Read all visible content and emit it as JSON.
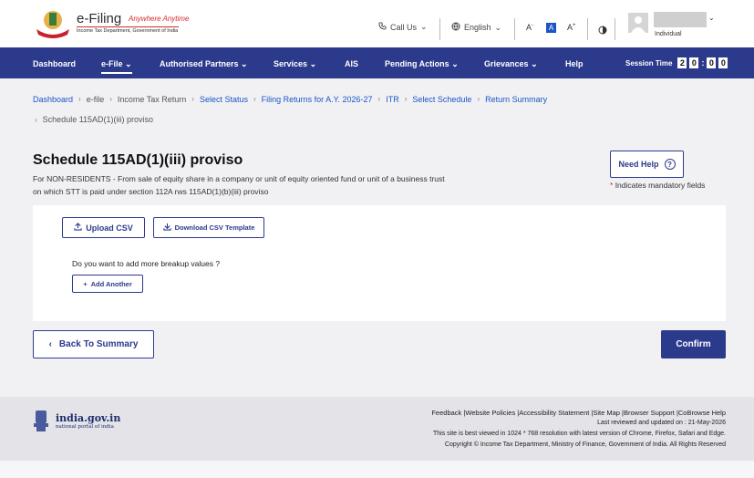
{
  "header": {
    "logo_title": "e-Filing",
    "logo_tagline": "Anywhere Anytime",
    "logo_subtitle": "Income Tax Department, Government of India",
    "call_us": "Call Us",
    "language": "English",
    "font_decrease": "A",
    "font_normal": "A",
    "font_increase": "A",
    "user_role": "Individual"
  },
  "nav": {
    "items": [
      {
        "label": "Dashboard"
      },
      {
        "label": "e-File"
      },
      {
        "label": "Authorised Partners"
      },
      {
        "label": "Services"
      },
      {
        "label": "AIS"
      },
      {
        "label": "Pending Actions"
      },
      {
        "label": "Grievances"
      },
      {
        "label": "Help"
      }
    ],
    "session_label": "Session Time",
    "session_digits": [
      "2",
      "0",
      "0",
      "0"
    ]
  },
  "breadcrumb": {
    "items": [
      {
        "label": "Dashboard"
      },
      {
        "label": "e-file"
      },
      {
        "label": "Income Tax Return"
      },
      {
        "label": "Select Status"
      },
      {
        "label": "Filing Returns for A.Y. 2026-27"
      },
      {
        "label": "ITR"
      },
      {
        "label": "Select Schedule"
      },
      {
        "label": "Return Summary"
      }
    ],
    "current": "Schedule 115AD(1)(iii) proviso"
  },
  "main": {
    "title": "Schedule 115AD(1)(iii) proviso",
    "description_line1": "For NON-RESIDENTS - From sale of equity share in a company or unit of equity oriented fund or unit of a business trust",
    "description_line2": "on which STT is paid under section 112A rws 115AD(1)(b)(iii) proviso",
    "help_label": "Need Help",
    "mandatory_star": "*",
    "mandatory_note": "Indicates mandatory fields",
    "upload_csv": "Upload CSV",
    "download_template": "Download CSV Template",
    "breakup_question": "Do you want to add more breakup values ?",
    "add_another": "Add Another",
    "back_label": "Back To Summary",
    "confirm_label": "Confirm"
  },
  "footer": {
    "site_name": "india.gov.in",
    "site_sub": "national portal of india",
    "links": "Feedback |Website Policies |Accessibility Statement |Site Map |Browser Support |CoBrowse Help",
    "last_reviewed": "Last reviewed and updated on : 21-May-2026",
    "best_viewed": "This site is best viewed in 1024 * 768 resolution with latest version of Chrome, Firefox, Safari and Edge.",
    "copyright": "Copyright © Income Tax Department, Ministry of Finance, Government of India. All Rights Reserved"
  },
  "colors": {
    "primary": "#2c3a8c",
    "link": "#1a55c6",
    "accent_red": "#d62b2b"
  }
}
